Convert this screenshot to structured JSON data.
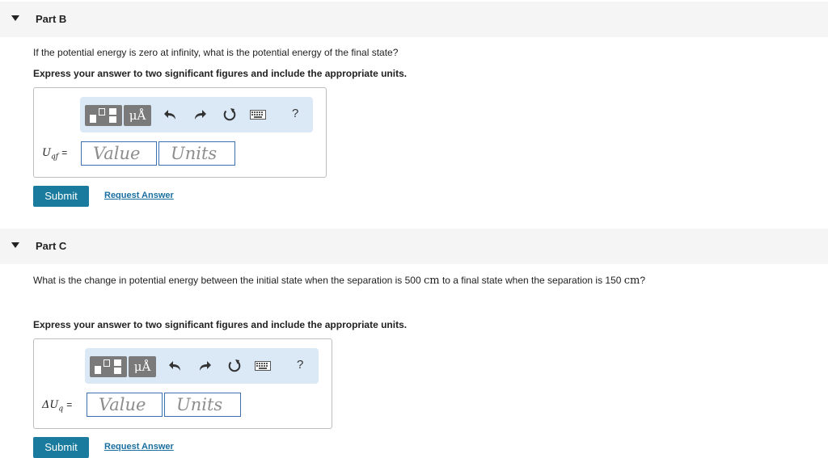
{
  "part_b": {
    "header": "Part B",
    "question": "If the potential energy is zero at infinity, what is the potential energy of the final state?",
    "instruction": "Express your answer to two significant figures and include the appropriate units.",
    "toolbar": {
      "units_label": "μÅ",
      "help_label": "?"
    },
    "variable": {
      "symbol": "U",
      "subscript": "qf",
      "equals": "="
    },
    "value_placeholder": "Value",
    "units_placeholder": "Units",
    "submit_label": "Submit",
    "request_label": "Request Answer"
  },
  "part_c": {
    "header": "Part C",
    "question_pre": "What is the change in potential energy between the initial state when the separation is 500",
    "unit_1": "cm",
    "question_mid": "to a final state when the separation is 150",
    "unit_2": "cm",
    "question_end": "?",
    "instruction": "Express your answer to two significant figures and include the appropriate units.",
    "toolbar": {
      "units_label": "μÅ",
      "help_label": "?"
    },
    "variable": {
      "symbol": "ΔU",
      "subscript": "q",
      "equals": "="
    },
    "value_placeholder": "Value",
    "units_placeholder": "Units",
    "submit_label": "Submit",
    "request_label": "Request Answer"
  },
  "icons": [
    "caret-down-icon",
    "templates-icon",
    "undo-icon",
    "redo-icon",
    "reset-icon",
    "keyboard-icon",
    "help-icon"
  ],
  "colors": {
    "submit_bg": "#1a7b9e",
    "link": "#1a6fa0",
    "field_border": "#3a6fb0",
    "toolbar_bg": "#dbe9f7"
  }
}
